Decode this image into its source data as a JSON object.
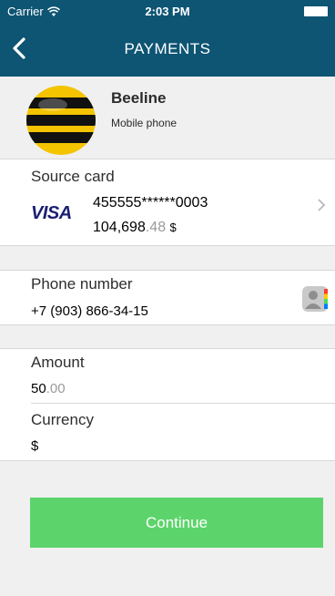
{
  "status_bar": {
    "carrier": "Carrier",
    "time": "2:03 PM"
  },
  "nav": {
    "title": "PAYMENTS",
    "back_icon": "chevron-left-icon"
  },
  "provider": {
    "name": "Beeline",
    "type": "Mobile phone"
  },
  "source_card": {
    "label": "Source card",
    "brand": "VISA",
    "number": "455555******0003",
    "balance_whole": "104,698",
    "balance_fraction": ".48",
    "currency": "$"
  },
  "phone": {
    "label": "Phone number",
    "value": "+7 (903) 866-34-15"
  },
  "amount": {
    "label": "Amount",
    "value_whole": "50",
    "value_fraction": ".00"
  },
  "currency": {
    "label": "Currency",
    "value": "$"
  },
  "actions": {
    "continue_label": "Continue"
  },
  "colors": {
    "navbar": "#0e5473",
    "button": "#5cd46b",
    "background": "#f0f0f0"
  }
}
